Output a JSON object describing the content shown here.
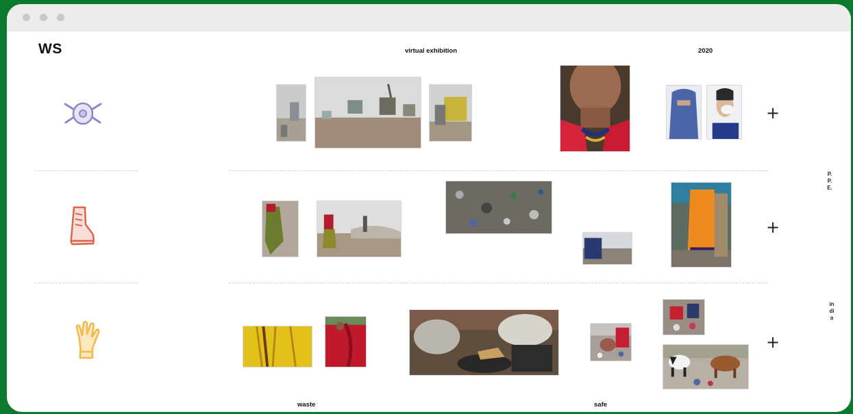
{
  "header": {
    "logo": "WS",
    "center_label": "virtual exhibition",
    "year_label": "2020"
  },
  "side_labels": {
    "top": "P.P.E.",
    "bottom": "india"
  },
  "footer": {
    "left_label": "waste",
    "right_label": "safe"
  },
  "rows": [
    {
      "icon": "face-mask-icon",
      "action": "+"
    },
    {
      "icon": "work-boot-icon",
      "action": "+"
    },
    {
      "icon": "glove-icon",
      "action": "+"
    }
  ],
  "colors": {
    "frame": "#0b7a2f",
    "mask_icon": "#8f86c9",
    "boot_icon": "#d9644f",
    "glove_icon": "#f2b94a"
  }
}
